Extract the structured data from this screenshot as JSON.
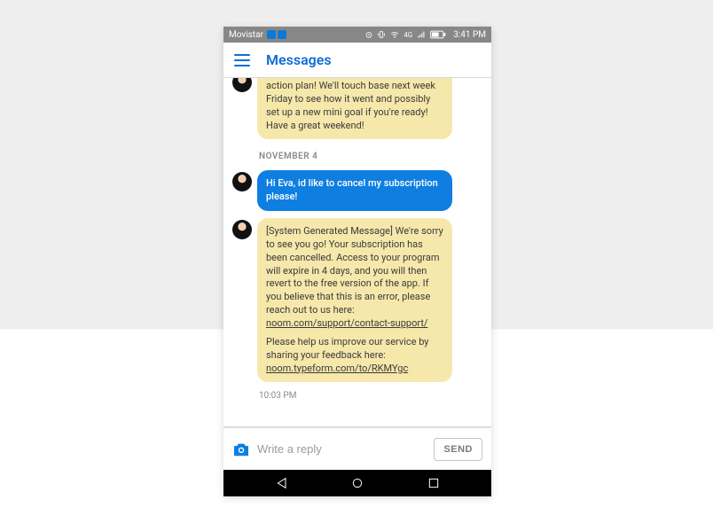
{
  "statusbar": {
    "carrier": "Movistar",
    "network_label": "4G",
    "clock": "3:41 PM"
  },
  "header": {
    "title": "Messages"
  },
  "chat": {
    "truncated_bubble": "action plan! We'll touch base next week Friday to see how it went and possibly set up a new mini goal if you're ready! Have a great weekend!",
    "date_separator": "NOVEMBER 4",
    "user_bubble": "Hi Eva, id like to cancel my subscription please!",
    "system_bubble": {
      "p1": "[System Generated Message] We're sorry to see you go! Your subscription has been cancelled. Access to your program will expire in 4 days, and you will then revert to the free version of the app. If you believe that this is an error, please reach out to us here:",
      "link1": "noom.com/support/contact-support/",
      "p2": "Please help us improve our service by sharing your feedback here:",
      "link2": "noom.typeform.com/to/RKMYgc"
    },
    "timestamp": "10:03 PM"
  },
  "reply": {
    "placeholder": "Write a reply",
    "send_label": "SEND"
  }
}
